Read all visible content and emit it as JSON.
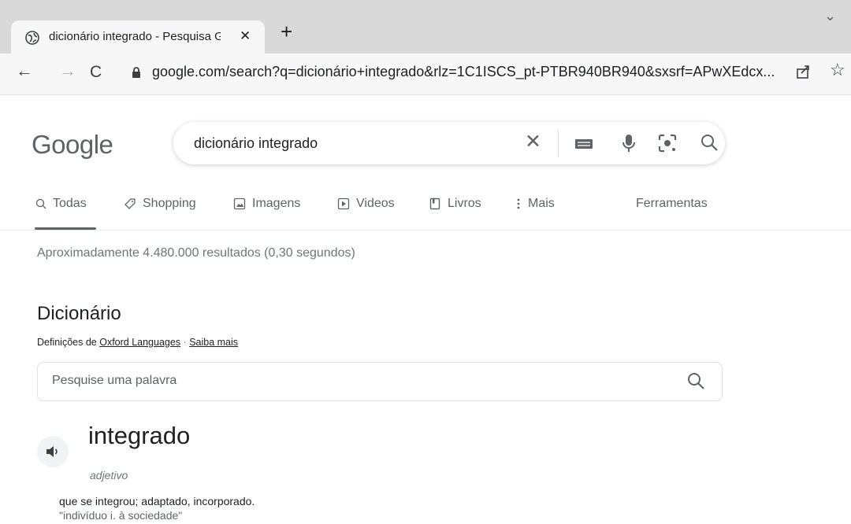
{
  "browser": {
    "tab_title": "dicionário integrado - Pesquisa G",
    "tab_close": "✕",
    "new_tab": "+",
    "tab_menu": "⌄",
    "back": "←",
    "forward": "→",
    "reload": "C",
    "url": "google.com/search?q=dicionário+integrado&rlz=1C1ISCS_pt-PTBR940BR940&sxsrf=APwXEdcx...",
    "star": "☆"
  },
  "google": {
    "logo": "Google",
    "query": "dicionário integrado",
    "clear": "✕"
  },
  "tabs": {
    "todas": "Todas",
    "shopping": "Shopping",
    "imagens": "Imagens",
    "videos": "Videos",
    "livros": "Livros",
    "mais": "Mais",
    "ferramentas": "Ferramentas"
  },
  "results": {
    "stats": "Aproximadamente 4.480.000 resultados (0,30 segundos)"
  },
  "dictionary": {
    "heading": "Dicionário",
    "source_prefix": "Definições de ",
    "source_link": "Oxford Languages",
    "separator": " · ",
    "learn_more": "Saiba mais",
    "search_placeholder": "Pesquise uma palavra",
    "headword": "integrado",
    "part_of_speech": "adjetivo",
    "definition": "que se integrou; adaptado, incorporado.",
    "example": "\"indivíduo i. à sociedade\""
  },
  "colors": {
    "text": "#202124",
    "muted": "#5f6368",
    "stats": "#70757a"
  },
  "icons": [
    "globe-icon",
    "lock-icon",
    "share-icon",
    "star-icon",
    "keyboard-icon",
    "mic-icon",
    "lens-icon",
    "search-icon",
    "tag-icon",
    "image-icon",
    "play-icon",
    "book-icon",
    "more-vert-icon",
    "speaker-icon"
  ]
}
